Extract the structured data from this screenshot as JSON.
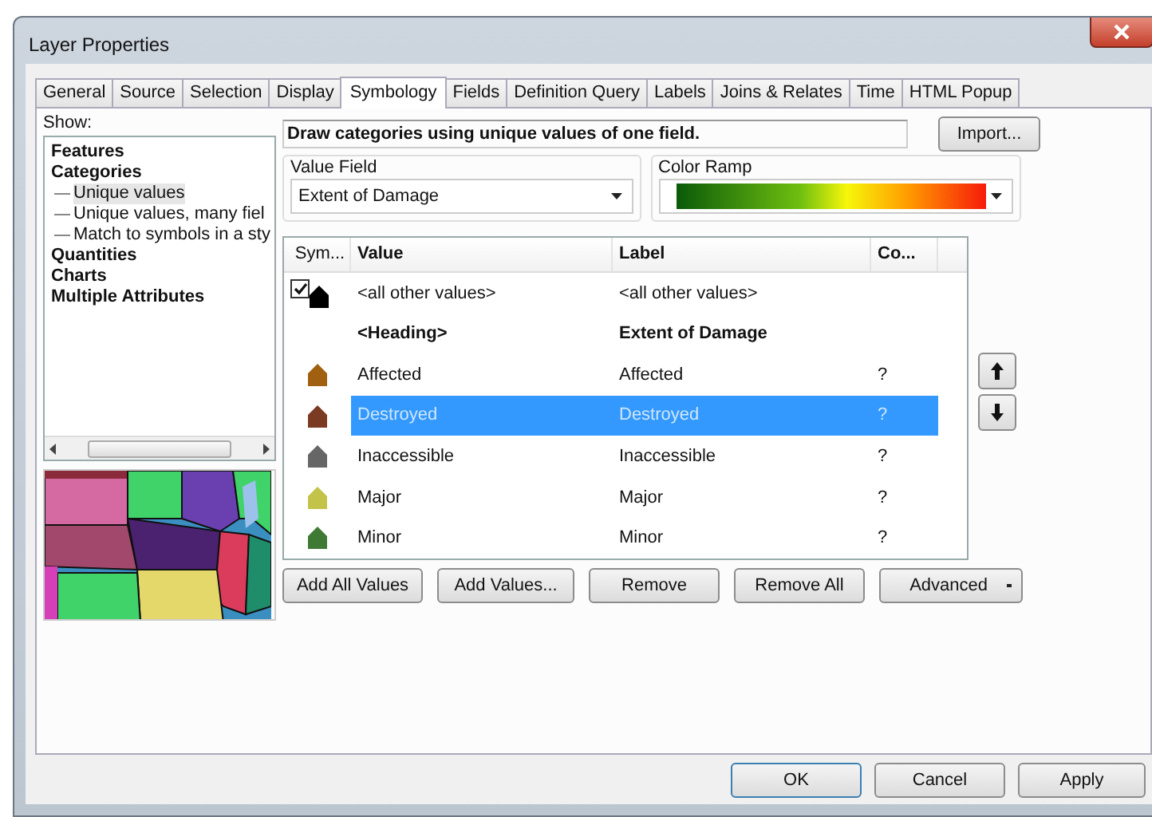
{
  "window": {
    "title": "Layer Properties"
  },
  "tabs": [
    {
      "label": "General",
      "selected": false
    },
    {
      "label": "Source",
      "selected": false
    },
    {
      "label": "Selection",
      "selected": false
    },
    {
      "label": "Display",
      "selected": false
    },
    {
      "label": "Symbology",
      "selected": true
    },
    {
      "label": "Fields",
      "selected": false
    },
    {
      "label": "Definition Query",
      "selected": false
    },
    {
      "label": "Labels",
      "selected": false
    },
    {
      "label": "Joins & Relates",
      "selected": false
    },
    {
      "label": "Time",
      "selected": false
    },
    {
      "label": "HTML Popup",
      "selected": false
    }
  ],
  "show": {
    "label": "Show:",
    "items": [
      {
        "label": "Features",
        "selected": false
      },
      {
        "label": "Categories",
        "selected": false,
        "children": [
          {
            "label": "Unique values",
            "selected": true
          },
          {
            "label": "Unique values, many fiel",
            "selected": false
          },
          {
            "label": "Match to symbols in a sty",
            "selected": false
          }
        ]
      },
      {
        "label": "Quantities",
        "selected": false
      },
      {
        "label": "Charts",
        "selected": false
      },
      {
        "label": "Multiple Attributes",
        "selected": false
      }
    ]
  },
  "description": "Draw categories using unique values of one field.",
  "import_button": "Import...",
  "value_field": {
    "label": "Value Field",
    "value": "Extent of Damage"
  },
  "color_ramp": {
    "label": "Color Ramp"
  },
  "table": {
    "columns": [
      "Sym...",
      "Value",
      "Label",
      "Co..."
    ],
    "rows": [
      {
        "kind": "other",
        "checked": true,
        "color": "#000000",
        "value": "<all other values>",
        "label": "<all other values>",
        "selected": false
      },
      {
        "kind": "heading",
        "value": "<Heading>",
        "label": "Extent of Damage",
        "selected": false
      },
      {
        "kind": "value",
        "color": "#a0600f",
        "value": "Affected",
        "label": "Affected",
        "count": "?",
        "selected": false
      },
      {
        "kind": "value",
        "color": "#7a3b22",
        "value": "Destroyed",
        "label": "Destroyed",
        "count": "?",
        "selected": true
      },
      {
        "kind": "value",
        "color": "#666666",
        "value": "Inaccessible",
        "label": "Inaccessible",
        "count": "?",
        "selected": false
      },
      {
        "kind": "value",
        "color": "#c3c34a",
        "value": "Major",
        "label": "Major",
        "count": "?",
        "selected": false
      },
      {
        "kind": "value",
        "color": "#3f7a35",
        "value": "Minor",
        "label": "Minor",
        "count": "?",
        "selected": false
      }
    ]
  },
  "list_buttons": [
    "Add All Values",
    "Add Values...",
    "Remove",
    "Remove All",
    "Advanced"
  ],
  "dialog_buttons": [
    "OK",
    "Cancel",
    "Apply"
  ]
}
